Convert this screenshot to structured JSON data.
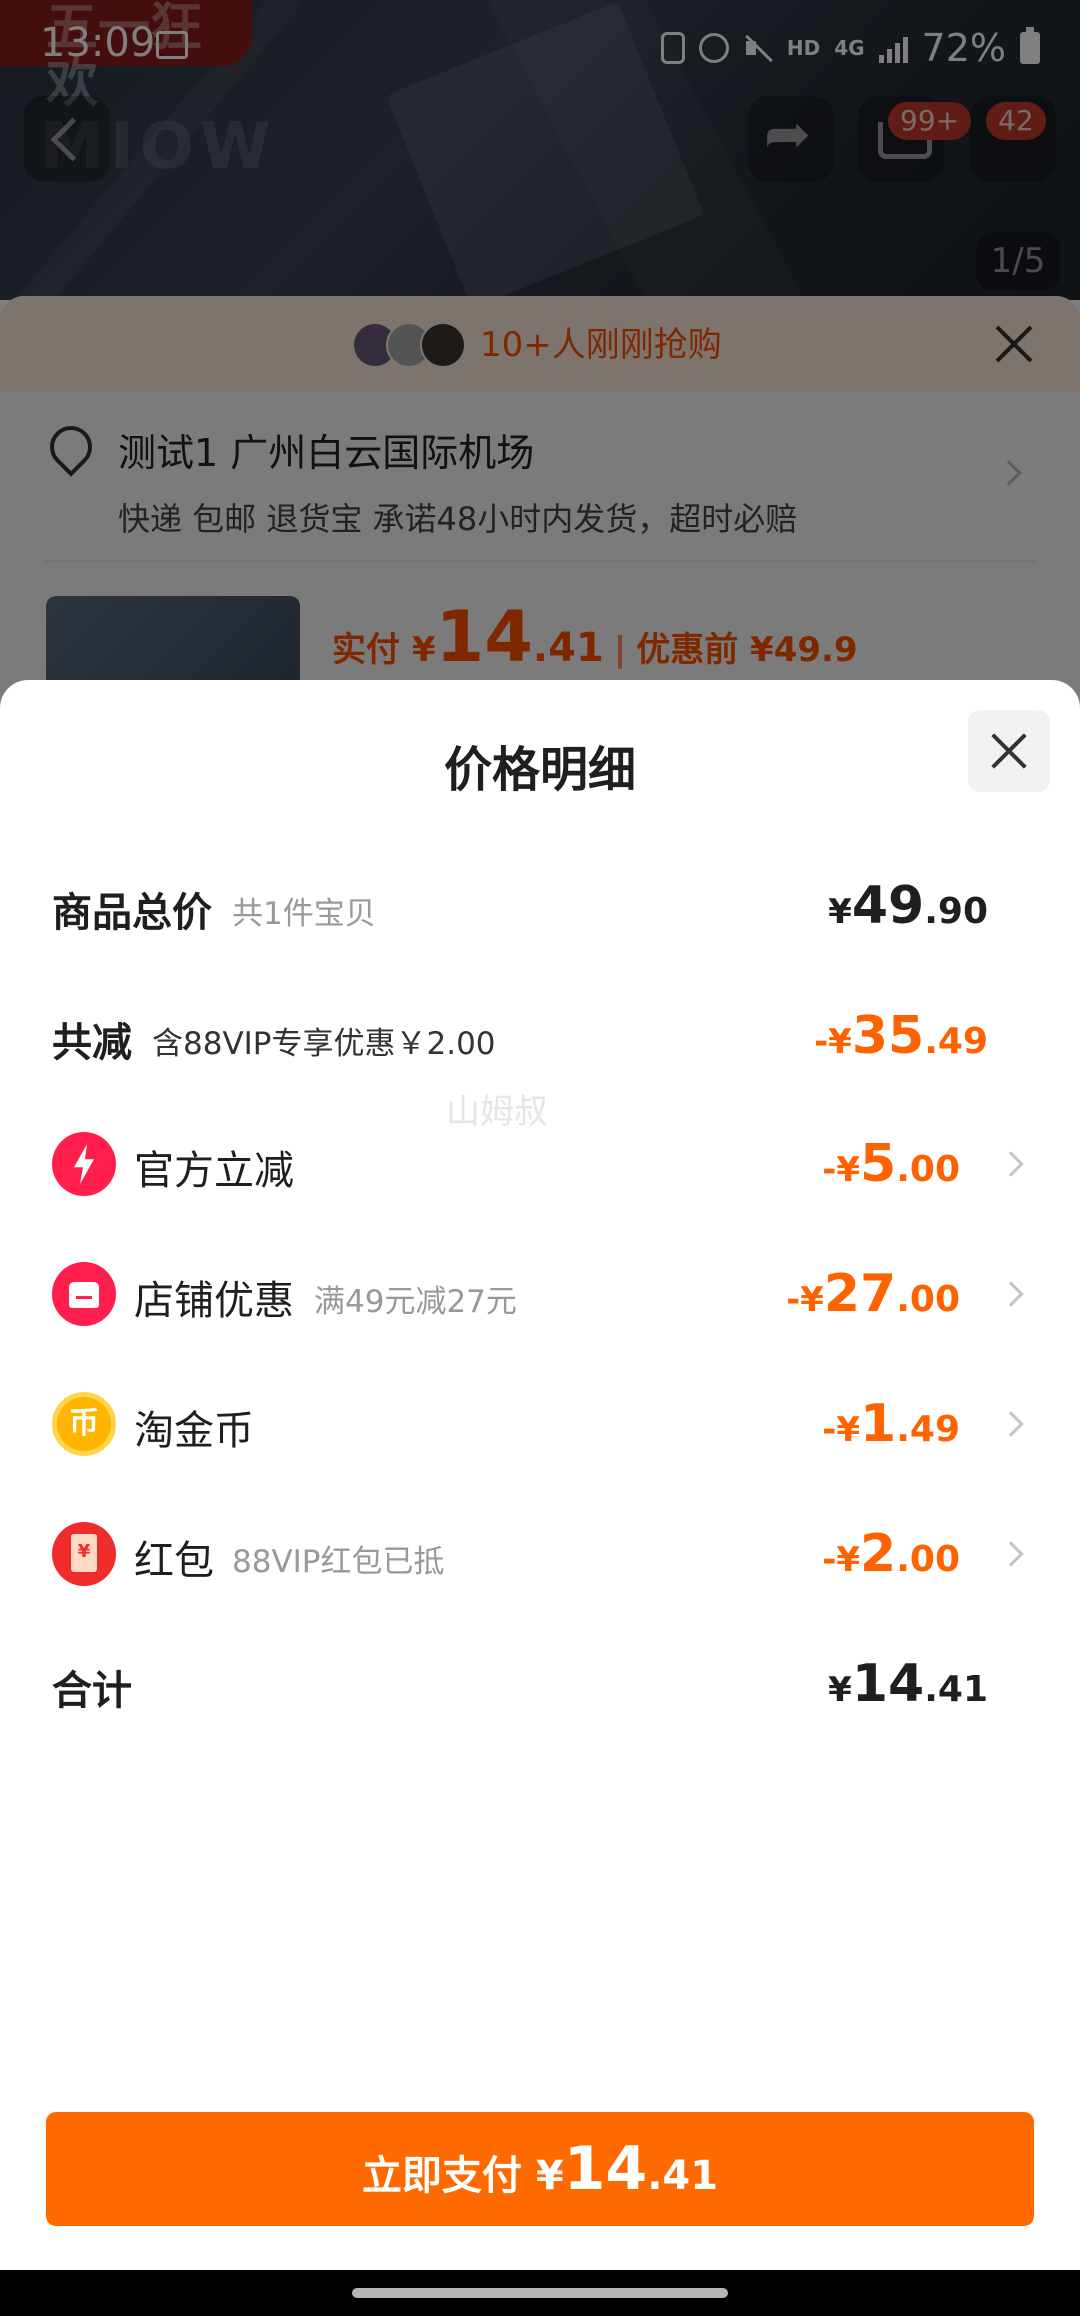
{
  "status_bar": {
    "time": "13:09",
    "network_hd": "HD",
    "network_4g": "4G",
    "battery": "72%"
  },
  "background": {
    "promo_tag": "五一狂欢",
    "logo_watermark": "MIOW",
    "cart_badge": "99+",
    "more_badge": "42",
    "image_counter": "1/5",
    "buyers_text": "10+人刚刚抢购",
    "address_line1": "测试1 广州白云国际机场",
    "address_line2": "快递 包邮 退货宝 承诺48小时内发货，超时必赔",
    "price_summary": {
      "paid_label": "实付 ¥",
      "paid_int": "14",
      "paid_dec": ".41",
      "separator": "|",
      "before_label": "优惠前 ¥49.9"
    }
  },
  "sheet": {
    "title": "价格明细",
    "watermark": "山姆叔",
    "rows": {
      "total": {
        "label": "商品总价",
        "sub": "共1件宝贝",
        "prefix": "¥",
        "int": "49",
        "dec": ".90"
      },
      "reduce": {
        "label": "共减",
        "sub": "含88VIP专享优惠￥2.00",
        "prefix": "-¥",
        "int": "35",
        "dec": ".49"
      },
      "official": {
        "icon": "lightning-icon",
        "label": "官方立减",
        "sub": "",
        "prefix": "-¥",
        "int": "5",
        "dec": ".00"
      },
      "shop": {
        "icon": "shop-icon",
        "label": "店铺优惠",
        "sub": "满49元减27元",
        "prefix": "-¥",
        "int": "27",
        "dec": ".00"
      },
      "coin": {
        "icon": "coin-icon",
        "label": "淘金币",
        "sub": "",
        "prefix": "-¥",
        "int": "1",
        "dec": ".49"
      },
      "redpacket": {
        "icon": "red-packet-icon",
        "label": "红包",
        "sub": "88VIP红包已抵",
        "prefix": "-¥",
        "int": "2",
        "dec": ".00"
      },
      "sum": {
        "label": "合计",
        "prefix": "¥",
        "int": "14",
        "dec": ".41"
      }
    },
    "pay_button": {
      "label": "立即支付 ¥",
      "int": "14",
      "dec": ".41"
    }
  },
  "colors": {
    "accent_orange": "#ff6200",
    "pay_button": "#ff6a00",
    "icon_red": "#ff1e4c",
    "coin_gold": "#ffb400"
  }
}
